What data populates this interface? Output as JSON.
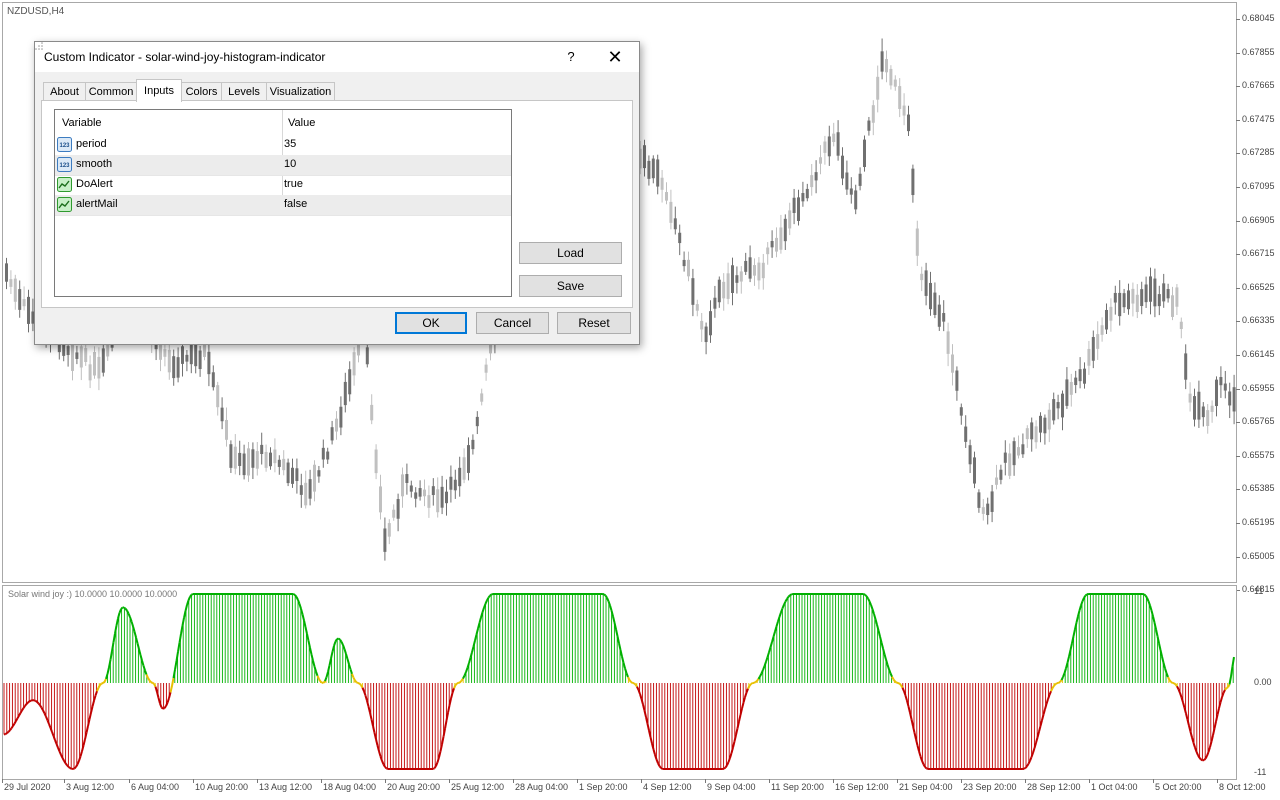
{
  "chart": {
    "symbol_label": "NZDUSD,H4",
    "up_color": "#c0c0c0",
    "down_color": "#707070",
    "price_axis_labels": [
      "0.68045",
      "0.67855",
      "0.67665",
      "0.67475",
      "0.67285",
      "0.67095",
      "0.66905",
      "0.66715",
      "0.66525",
      "0.66335",
      "0.66145",
      "0.65955",
      "0.65765",
      "0.65575",
      "0.65385",
      "0.65195",
      "0.65005",
      "0.64815"
    ],
    "time_axis_labels": [
      "29 Jul 2020",
      "3 Aug 12:00",
      "6 Aug 04:00",
      "10 Aug 20:00",
      "13 Aug 12:00",
      "18 Aug 04:00",
      "20 Aug 20:00",
      "25 Aug 12:00",
      "28 Aug 04:00",
      "1 Sep 20:00",
      "4 Sep 12:00",
      "9 Sep 04:00",
      "11 Sep 20:00",
      "16 Sep 12:00",
      "21 Sep 04:00",
      "23 Sep 20:00",
      "28 Sep 12:00",
      "1 Oct 04:00",
      "5 Oct 20:00",
      "8 Oct 12:00"
    ]
  },
  "indicator": {
    "label": "Solar wind joy :) 10.0000 10.0000 10.0000",
    "axis_labels": [
      "11",
      "0.00",
      "-11"
    ],
    "up_color": "#00b000",
    "down_color": "#c00000",
    "cross_color": "#e8c000"
  },
  "dialog": {
    "title": "Custom Indicator - solar-wind-joy-histogram-indicator",
    "help_label": "?",
    "close_label": "✕",
    "tabs": [
      {
        "label": "About",
        "active": false
      },
      {
        "label": "Common",
        "active": false
      },
      {
        "label": "Inputs",
        "active": true
      },
      {
        "label": "Colors",
        "active": false
      },
      {
        "label": "Levels",
        "active": false
      },
      {
        "label": "Visualization",
        "active": false
      }
    ],
    "grid": {
      "columns": [
        "Variable",
        "Value"
      ],
      "rows": [
        {
          "icon": "numeric-icon",
          "name": "period",
          "value": "35"
        },
        {
          "icon": "numeric-icon",
          "name": "smooth",
          "value": "10"
        },
        {
          "icon": "boolean-icon",
          "name": "DoAlert",
          "value": "true"
        },
        {
          "icon": "boolean-icon",
          "name": "alertMail",
          "value": "false"
        }
      ]
    },
    "buttons": {
      "load": "Load",
      "save": "Save",
      "ok": "OK",
      "cancel": "Cancel",
      "reset": "Reset"
    }
  }
}
